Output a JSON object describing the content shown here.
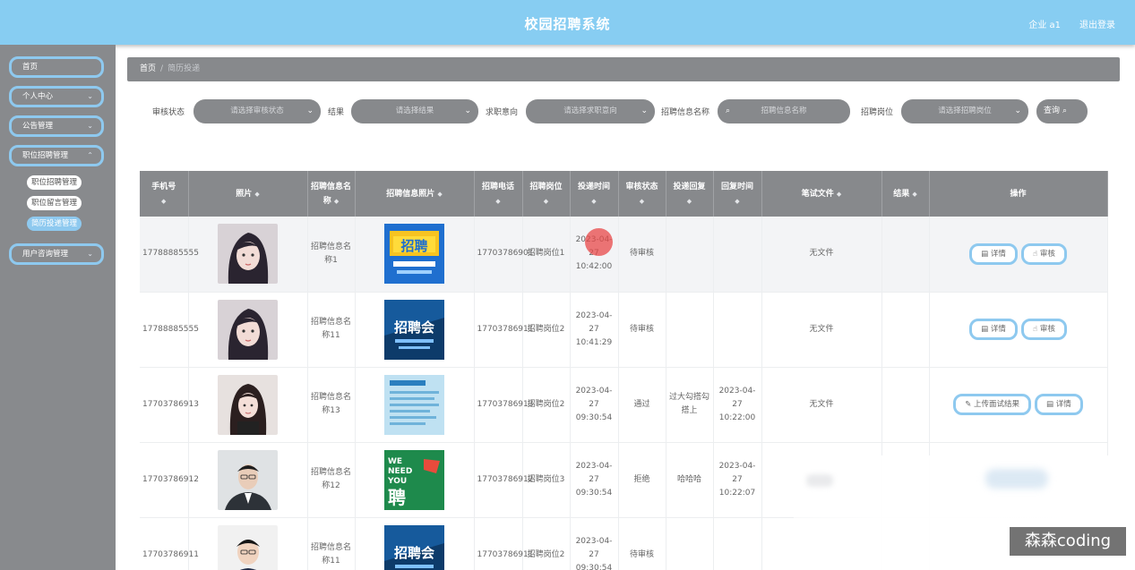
{
  "header": {
    "title": "校园招聘系统",
    "user": "企业 a1",
    "logout": "退出登录"
  },
  "sidebar": {
    "items": [
      {
        "label": "首页"
      },
      {
        "label": "个人中心"
      },
      {
        "label": "公告管理"
      },
      {
        "label": "职位招聘管理"
      },
      {
        "label": "用户咨询管理"
      }
    ],
    "sub_items": [
      {
        "label": "职位招聘管理"
      },
      {
        "label": "职位留言管理"
      },
      {
        "label": "简历投递管理"
      }
    ]
  },
  "breadcrumb": {
    "home": "首页",
    "separator": "/",
    "current": "简历投递"
  },
  "filters": {
    "review_status_label": "审核状态",
    "review_status_placeholder": "请选择审核状态",
    "result_label": "结果",
    "result_placeholder": "请选择结果",
    "intention_label": "求职意向",
    "intention_placeholder": "请选择求职意向",
    "info_name_label": "招聘信息名称",
    "info_name_placeholder": "招聘信息名称",
    "position_label": "招聘岗位",
    "position_placeholder": "请选择招聘岗位",
    "search_button": "查询"
  },
  "table": {
    "columns": [
      "手机号",
      "照片",
      "招聘信息名称",
      "招聘信息照片",
      "招聘电话",
      "招聘岗位",
      "投递时间",
      "审核状态",
      "投递回复",
      "回复时间",
      "笔试文件",
      "结果",
      "操作"
    ],
    "sort_icon": "◆",
    "rows": [
      {
        "phone": "17788885555",
        "info_name": "招聘信息名称1",
        "tel": "17703786901",
        "position": "招聘岗位1",
        "time": "2023-04-27 10:42:00",
        "status": "待审核",
        "reply": "",
        "reply_time": "",
        "file": "无文件",
        "result": "",
        "photo": "woman-portrait-1",
        "poster": "zhaopin-blue",
        "ops": [
          "详情",
          "审核"
        ]
      },
      {
        "phone": "17788885555",
        "info_name": "招聘信息名称11",
        "tel": "17703786911",
        "position": "招聘岗位2",
        "time": "2023-04-27 10:41:29",
        "status": "待审核",
        "reply": "",
        "reply_time": "",
        "file": "无文件",
        "result": "",
        "photo": "woman-portrait-1",
        "poster": "zhaopinhui-dark",
        "ops": [
          "详情",
          "审核"
        ]
      },
      {
        "phone": "17703786913",
        "info_name": "招聘信息名称13",
        "tel": "17703786913",
        "position": "招聘岗位2",
        "time": "2023-04-27 09:30:54",
        "status": "通过",
        "reply": "过大勾搭勾搭上",
        "reply_time": "2023-04-27 10:22:00",
        "file": "无文件",
        "result": "",
        "photo": "woman-portrait-2",
        "poster": "zhaopin-light-blue",
        "ops": [
          "上传面试结果",
          "详情"
        ]
      },
      {
        "phone": "17703786912",
        "info_name": "招聘信息名称12",
        "tel": "17703786912",
        "position": "招聘岗位3",
        "time": "2023-04-27 09:30:54",
        "status": "拒绝",
        "reply": "哈哈哈",
        "reply_time": "2023-04-27 10:22:07",
        "file": "",
        "result": "",
        "photo": "man-portrait-1",
        "poster": "we-need-you-green",
        "ops": []
      },
      {
        "phone": "17703786911",
        "info_name": "招聘信息名称11",
        "tel": "17703786911",
        "position": "招聘岗位2",
        "time": "2023-04-27 09:30:54",
        "status": "待审核",
        "reply": "",
        "reply_time": "",
        "file": "",
        "result": "",
        "photo": "man-portrait-2",
        "poster": "zhaopinhui-dark",
        "ops": []
      }
    ]
  },
  "icons": {
    "chevron": "chevron-down-icon",
    "search": "search-icon",
    "detail": "document-icon",
    "audit": "hand-icon",
    "upload": "edit-icon"
  },
  "watermark": "森森coding",
  "colors": {
    "header": "#87cdf2",
    "sidebar": "#888a8d",
    "accent_border": "#8ec9ef"
  }
}
